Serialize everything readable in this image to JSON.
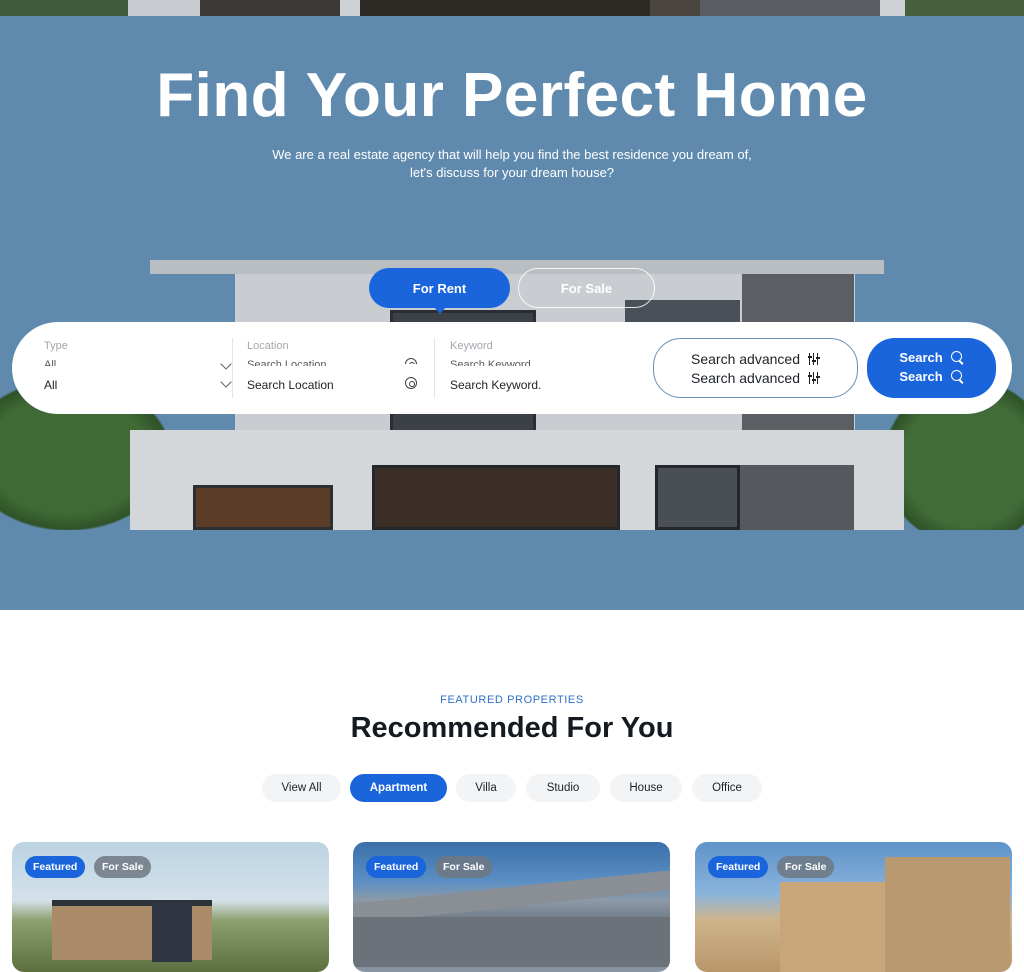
{
  "hero": {
    "title": "Find Your Perfect Home",
    "subtitle": "We are a real estate agency that will help you find the best residence you dream of, let's discuss for your dream house?",
    "tabs": [
      {
        "label": "For Rent",
        "active": true
      },
      {
        "label": "For Sale",
        "active": false
      }
    ]
  },
  "search": {
    "type": {
      "label": "Type",
      "value": "All",
      "icon": "chevron-down-icon"
    },
    "location": {
      "label": "Location",
      "placeholder": "Search Location",
      "icon": "target-icon"
    },
    "keyword": {
      "label": "Keyword",
      "placeholder": "Search Keyword."
    },
    "advanced_label": "Search advanced",
    "advanced_icon": "sliders-icon",
    "search_label": "Search",
    "search_icon": "search-icon"
  },
  "featured": {
    "eyebrow": "FEATURED PROPERTIES",
    "title": "Recommended For You",
    "filters": [
      {
        "label": "View All",
        "active": false
      },
      {
        "label": "Apartment",
        "active": true
      },
      {
        "label": "Villa",
        "active": false
      },
      {
        "label": "Studio",
        "active": false
      },
      {
        "label": "House",
        "active": false
      },
      {
        "label": "Office",
        "active": false
      }
    ],
    "cards": [
      {
        "badges": [
          "Featured",
          "For Sale"
        ]
      },
      {
        "badges": [
          "Featured",
          "For Sale"
        ]
      },
      {
        "badges": [
          "Featured",
          "For Sale"
        ]
      }
    ]
  },
  "colors": {
    "primary": "#1a64dc",
    "hero_bg": "#5f8aae",
    "eyebrow": "#2f6fc4",
    "heading": "#141a22"
  }
}
